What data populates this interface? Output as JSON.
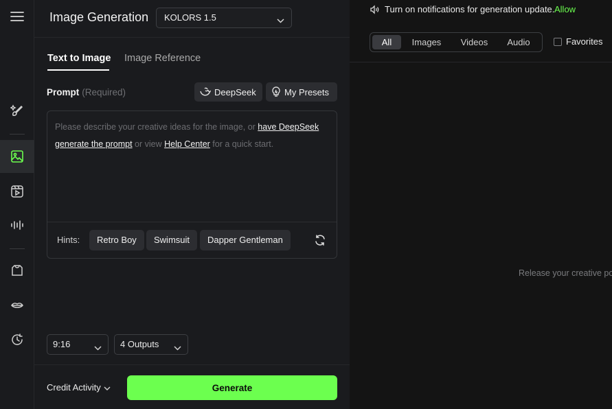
{
  "rail": {
    "items": [
      {
        "icon": "magic-brush-icon"
      },
      {
        "icon": "image-icon",
        "active": true
      },
      {
        "icon": "video-icon"
      },
      {
        "icon": "audio-wave-icon"
      },
      {
        "icon": "shirt-icon"
      },
      {
        "icon": "lips-icon"
      },
      {
        "icon": "history-icon"
      }
    ]
  },
  "header": {
    "title": "Image Generation",
    "model": "KOLORS 1.5"
  },
  "tabs": [
    {
      "label": "Text to Image",
      "active": true
    },
    {
      "label": "Image Reference",
      "active": false
    }
  ],
  "prompt": {
    "label": "Prompt",
    "required_text": "(Required)",
    "deepseek_label": "DeepSeek",
    "presets_label": "My Presets",
    "placeholder_part1": "Please describe your creative ideas for the image, or ",
    "placeholder_link1": "have DeepSeek generate the prompt",
    "placeholder_part2": " or view ",
    "placeholder_link2": "Help Center",
    "placeholder_part3": " for a quick start."
  },
  "hints": {
    "label": "Hints:",
    "chips": [
      "Retro Boy",
      "Swimsuit",
      "Dapper Gentleman"
    ]
  },
  "options": {
    "ratio": "9:16",
    "outputs": "4 Outputs"
  },
  "footer": {
    "credit_label": "Credit Activity",
    "generate_label": "Generate"
  },
  "notification": {
    "text": "Turn on notifications for generation update.",
    "allow": "Allow"
  },
  "filters": {
    "segments": [
      "All",
      "Images",
      "Videos",
      "Audio"
    ],
    "selected": "All",
    "favorites_label": "Favorites"
  },
  "empty_message": "Release your creative po",
  "colors": {
    "accent": "#6cff4f",
    "background": "#141414",
    "panel": "#1a1b1e"
  }
}
